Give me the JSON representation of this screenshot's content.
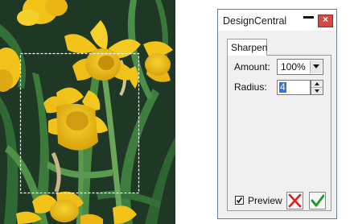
{
  "dialog": {
    "title": "DesignCentral",
    "tab_label": "Sharpen",
    "amount_label": "Amount:",
    "amount_value": "100%",
    "radius_label": "Radius:",
    "radius_value": "4",
    "preview_label": "Preview",
    "preview_checked": true
  },
  "icons": {
    "minimize": "minimize-icon",
    "close": "close-icon",
    "cancel": "red-x-icon",
    "ok": "green-check-icon"
  },
  "colors": {
    "close_button": "#d04b43",
    "cancel_red": "#e0201c",
    "ok_green": "#1f9a2c",
    "selection_blue": "#3a6fd8",
    "flower_yellow": "#f2c419",
    "foliage_green": "#1f4a22"
  }
}
